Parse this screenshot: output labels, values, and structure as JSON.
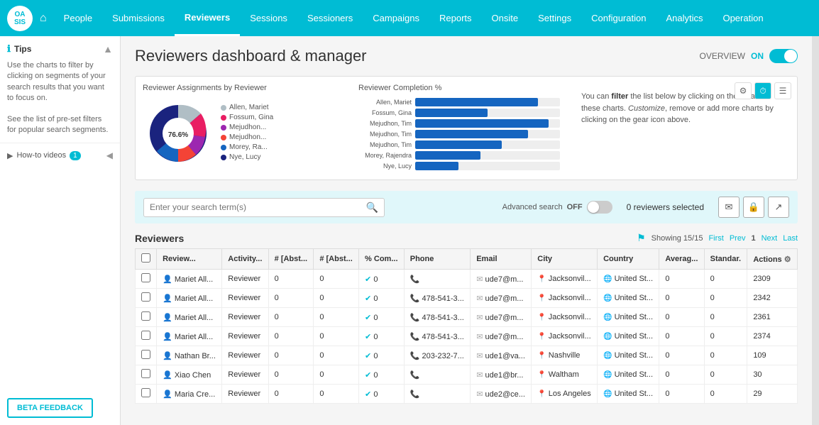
{
  "app": {
    "name": "OASIS",
    "logo_line1": "OA",
    "logo_line2": "SIS"
  },
  "nav": {
    "home_icon": "⌂",
    "items": [
      {
        "label": "People",
        "active": false
      },
      {
        "label": "Submissions",
        "active": false
      },
      {
        "label": "Reviewers",
        "active": true
      },
      {
        "label": "Sessions",
        "active": false
      },
      {
        "label": "Sessioners",
        "active": false
      },
      {
        "label": "Campaigns",
        "active": false
      },
      {
        "label": "Reports",
        "active": false
      },
      {
        "label": "Onsite",
        "active": false
      },
      {
        "label": "Settings",
        "active": false
      },
      {
        "label": "Configuration",
        "active": false
      },
      {
        "label": "Analytics",
        "active": false
      },
      {
        "label": "Operation",
        "active": false
      }
    ]
  },
  "sidebar": {
    "tips": {
      "title": "Tips",
      "icon": "ℹ",
      "text1": "Use the charts to filter by clicking on segments of your search results that you want to focus on.",
      "text2": "See the list of pre-set filters for popular search segments."
    },
    "videos": {
      "label": "How-to videos",
      "count": "1"
    },
    "beta_feedback": "BETA FEEDBACK"
  },
  "page": {
    "title": "Reviewers dashboard & manager",
    "overview_label": "OVERVIEW",
    "overview_on": "ON"
  },
  "charts": {
    "pie_title": "Reviewer Assignments by Reviewer",
    "bar_title": "Reviewer Completion %",
    "info_text_part1": "You can ",
    "info_bold": "filter",
    "info_text_part2": " the list below by clicking on the data in these charts. ",
    "info_italic": "Customize",
    "info_text_part3": ", remove or add more charts by clicking on the gear icon above.",
    "pie_label": "76.6%",
    "legend": [
      {
        "name": "Allen, Mariet",
        "color": "#b0bec5"
      },
      {
        "name": "Fossum, Gina",
        "color": "#e91e63"
      },
      {
        "name": "Mejudhon...",
        "color": "#9c27b0"
      },
      {
        "name": "Mejudhon...",
        "color": "#f44336"
      },
      {
        "name": "Morey, Ra...",
        "color": "#1565c0"
      },
      {
        "name": "Nye, Lucy",
        "color": "#1a237e"
      }
    ],
    "bars": [
      {
        "label": "Allen, Mariet",
        "pct": 85
      },
      {
        "label": "Fossum, Gina",
        "pct": 50
      },
      {
        "label": "Mejudhon, Tim",
        "pct": 92
      },
      {
        "label": "Mejudhon, Tim",
        "pct": 78
      },
      {
        "label": "Mejudhon, Tim",
        "pct": 60
      },
      {
        "label": "Morey, Rajendra",
        "pct": 45
      },
      {
        "label": "Nye, Lucy",
        "pct": 30
      }
    ]
  },
  "search": {
    "placeholder": "Enter your search term(s)",
    "advanced_label": "Advanced search",
    "advanced_state": "OFF",
    "selected_count": "0 reviewers selected"
  },
  "table": {
    "title": "Reviewers",
    "showing": "Showing 15/15",
    "pagination": {
      "first": "First",
      "prev": "Prev",
      "current": "1",
      "next": "Next",
      "last": "Last"
    },
    "columns": [
      "",
      "Review...",
      "Activity...",
      "# [Abst...",
      "# [Abst...",
      "% Com...",
      "Phone",
      "Email",
      "City",
      "Country",
      "Averag...",
      "Standar.",
      "Actions"
    ],
    "rows": [
      {
        "name": "Mariet All...",
        "activity": "Reviewer",
        "abs1": "0",
        "abs2": "0",
        "comp": "0",
        "phone": "",
        "email": "ude7@m...",
        "city": "Jacksonvil...",
        "country": "United St...",
        "avg": "0",
        "std": "0",
        "id": "2309"
      },
      {
        "name": "Mariet All...",
        "activity": "Reviewer",
        "abs1": "0",
        "abs2": "0",
        "comp": "0",
        "phone": "478-541-3...",
        "email": "ude7@m...",
        "city": "Jacksonvil...",
        "country": "United St...",
        "avg": "0",
        "std": "0",
        "id": "2342"
      },
      {
        "name": "Mariet All...",
        "activity": "Reviewer",
        "abs1": "0",
        "abs2": "0",
        "comp": "0",
        "phone": "478-541-3...",
        "email": "ude7@m...",
        "city": "Jacksonvil...",
        "country": "United St...",
        "avg": "0",
        "std": "0",
        "id": "2361"
      },
      {
        "name": "Mariet All...",
        "activity": "Reviewer",
        "abs1": "0",
        "abs2": "0",
        "comp": "0",
        "phone": "478-541-3...",
        "email": "ude7@m...",
        "city": "Jacksonvil...",
        "country": "United St...",
        "avg": "0",
        "std": "0",
        "id": "2374"
      },
      {
        "name": "Nathan Br...",
        "activity": "Reviewer",
        "abs1": "0",
        "abs2": "0",
        "comp": "0",
        "phone": "203-232-7...",
        "email": "ude1@va...",
        "city": "Nashville",
        "country": "United St...",
        "avg": "0",
        "std": "0",
        "id": "109"
      },
      {
        "name": "Xiao Chen",
        "activity": "Reviewer",
        "abs1": "0",
        "abs2": "0",
        "comp": "0",
        "phone": "",
        "email": "ude1@br...",
        "city": "Waltham",
        "country": "United St...",
        "avg": "0",
        "std": "0",
        "id": "30"
      },
      {
        "name": "Maria Cre...",
        "activity": "Reviewer",
        "abs1": "0",
        "abs2": "0",
        "comp": "0",
        "phone": "",
        "email": "ude2@ce...",
        "city": "Los Angeles",
        "country": "United St...",
        "avg": "0",
        "std": "0",
        "id": "29"
      }
    ]
  }
}
